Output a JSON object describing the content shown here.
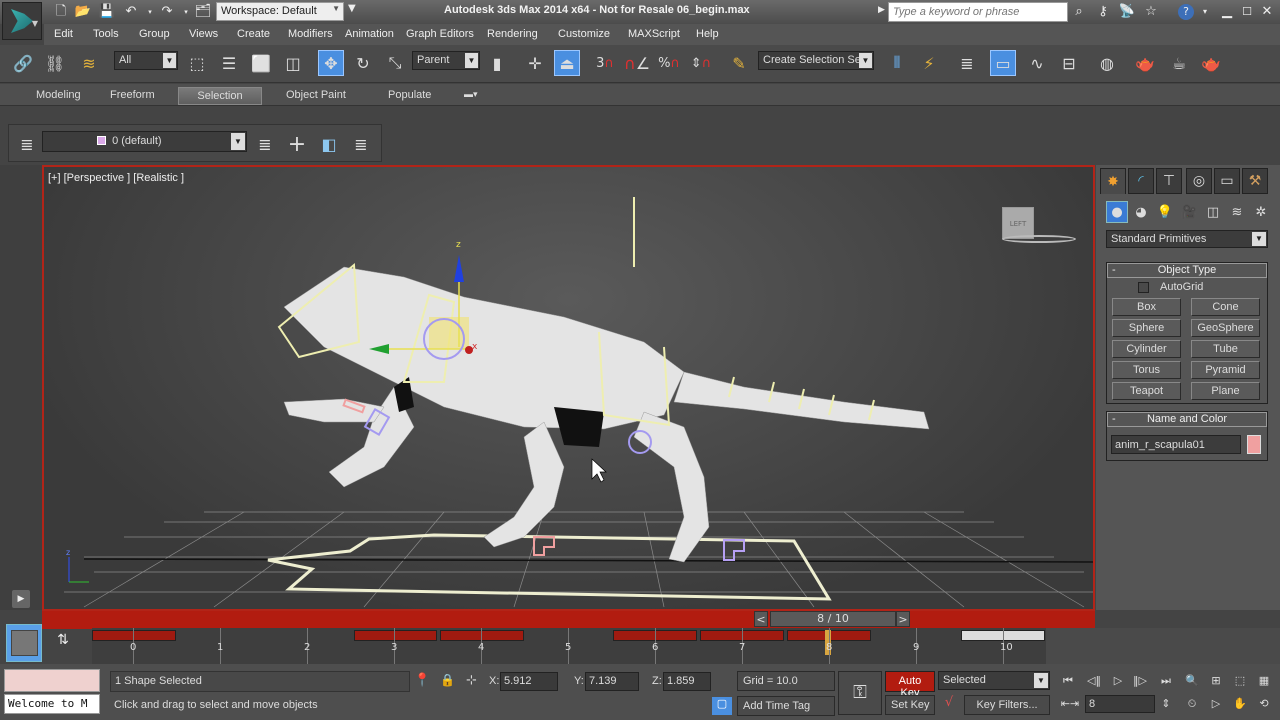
{
  "titlebar": {
    "workspace": "Workspace: Default",
    "title": "Autodesk 3ds Max  2014 x64  - Not for Resale   06_begin.max",
    "search_placeholder": "Type a keyword or phrase"
  },
  "menu": [
    "Edit",
    "Tools",
    "Group",
    "Views",
    "Create",
    "Modifiers",
    "Animation",
    "Graph Editors",
    "Rendering",
    "Customize",
    "MAXScript",
    "Help"
  ],
  "main_toolbar": {
    "selection_filter": "All",
    "ref_coord": "Parent",
    "named_selection": "Create Selection Se",
    "snap_label": "3"
  },
  "ribbon_tabs": [
    {
      "label": "Modeling",
      "selected": false
    },
    {
      "label": "Freeform",
      "selected": false
    },
    {
      "label": "Selection",
      "selected": true
    },
    {
      "label": "Object Paint",
      "selected": false
    },
    {
      "label": "Populate",
      "selected": false
    }
  ],
  "layer_toolbar": {
    "current_layer": "0 (default)"
  },
  "viewport": {
    "label": "[+] [Perspective ] [Realistic ]",
    "viewcube_face": "LEFT",
    "gizmo_axis_z": "z",
    "gizmo_axis_x": "x"
  },
  "time_slider": {
    "current_frame": 8,
    "total_frames": 10,
    "display": "8 / 10",
    "prev": "<",
    "next": ">"
  },
  "trackbar": {
    "ticks": [
      "0",
      "1",
      "2",
      "3",
      "4",
      "5",
      "6",
      "7",
      "8",
      "9",
      "10"
    ]
  },
  "command_panel": {
    "category": "Standard Primitives",
    "object_type_title": "Object Type",
    "autogrid_label": "AutoGrid",
    "autogrid_checked": false,
    "buttons": [
      "Box",
      "Cone",
      "Sphere",
      "GeoSphere",
      "Cylinder",
      "Tube",
      "Torus",
      "Pyramid",
      "Teapot",
      "Plane"
    ],
    "name_color_title": "Name and Color",
    "object_name": "anim_r_scapula01",
    "object_color": "#f0a0a0"
  },
  "status": {
    "maxscript_listener": "Welcome to M",
    "selection_status": "1 Shape Selected",
    "prompt": "Click and drag to select and move objects",
    "x_label": "X:",
    "x": "5.912",
    "y_label": "Y:",
    "y": "7.139",
    "z_label": "Z:",
    "z": "1.859",
    "grid": "Grid = 10.0",
    "add_time_tag": "Add Time Tag",
    "auto_key": "Auto Key",
    "set_key": "Set Key",
    "key_mode": "Selected",
    "key_filters": "Key Filters...",
    "frame": "8"
  },
  "colors": {
    "accent_red": "#b21c10",
    "active_blue": "#4a8fe0"
  }
}
